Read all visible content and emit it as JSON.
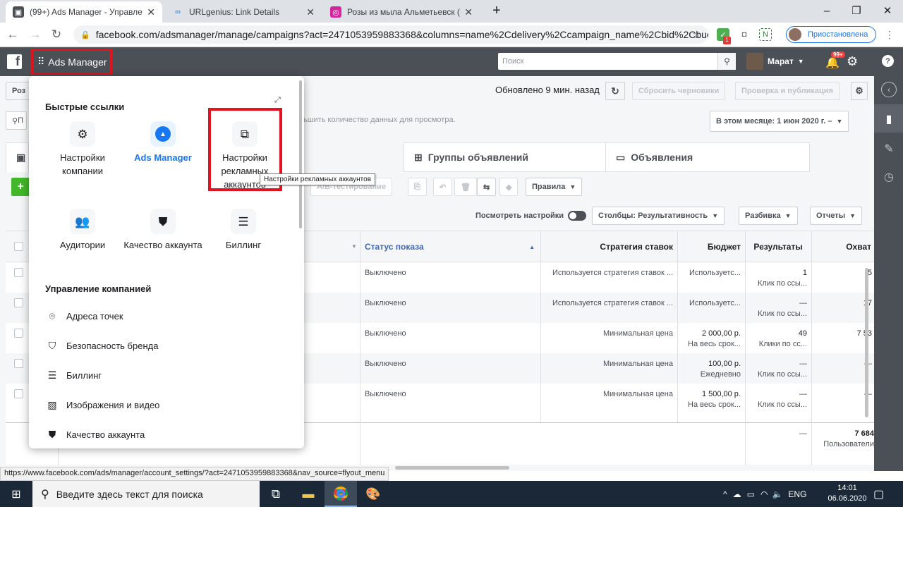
{
  "browser": {
    "tabs": [
      {
        "title": "(99+) Ads Manager - Управлени",
        "active": true
      },
      {
        "title": "URLgenius: Link Details",
        "active": false
      },
      {
        "title": "Розы из мыла Альметьевск (@а",
        "active": false
      }
    ],
    "new_tab": "+",
    "url": "facebook.com/adsmanager/manage/campaigns?act=2471053959883368&columns=name%2Cdelivery%2Ccampaign_name%2Cbid%2Cbudge...",
    "profile_label": "Приостановлена",
    "ext_badge": "1"
  },
  "fb": {
    "logo": "f",
    "app_title": "Ads Manager",
    "search_placeholder": "Поиск",
    "user_name": "Марат",
    "notif_badge": "99+"
  },
  "toolbar": {
    "left_button": "Роз",
    "updated": "Обновлено 9 мин. назад",
    "reset_drafts": "Сбросить черновики",
    "review_publish": "Проверка и публикация",
    "info_text": "ьшить количество данных для просмотра.",
    "date_range": "В этом месяце: 1 июн 2020 г. –",
    "rules": "Правила",
    "view_settings": "Посмотреть настройки",
    "columns": "Столбцы: Результативность",
    "breakdown": "Разбивка",
    "reports": "Отчеты",
    "test_label": "A/B-тестирование",
    "search_prefix": "П"
  },
  "level_tabs": {
    "adsets": "Группы объявлений",
    "ads": "Объявления"
  },
  "table": {
    "headers": {
      "delivery": "Статус показа",
      "bid": "Стратегия ставок",
      "budget": "Бюджет",
      "results": "Результаты",
      "reach": "Охват"
    },
    "rows": [
      {
        "delivery": "Выключено",
        "bid": "Используется стратегия ставок ...",
        "budget": "Используетс...",
        "budget2": "",
        "results": "1",
        "results2": "Клик по ссы...",
        "reach": "5"
      },
      {
        "delivery": "Выключено",
        "bid": "Используется стратегия ставок ...",
        "budget": "Используетс...",
        "budget2": "",
        "results": "—",
        "results2": "Клик по ссы...",
        "reach": "17"
      },
      {
        "delivery": "Выключено",
        "bid": "Минимальная цена",
        "budget": "2 000,00 р.",
        "budget2": "На весь срок...",
        "results": "49",
        "results2": "Клики по сс...",
        "reach": "7 53"
      },
      {
        "delivery": "Выключено",
        "bid": "Минимальная цена",
        "budget": "100,00 р.",
        "budget2": "Ежедневно",
        "results": "—",
        "results2": "Клик по ссы...",
        "reach": "—"
      },
      {
        "delivery": "Выключено",
        "bid": "Минимальная цена",
        "budget": "1 500,00 р.",
        "budget2": "На весь срок...",
        "results": "—",
        "results2": "Клик по ссы...",
        "reach": "—"
      }
    ],
    "total_results": "—",
    "total_reach": "7 684",
    "total_reach_label": "Пользователи"
  },
  "menu": {
    "quick_links_title": "Быстрые ссылки",
    "quick_links": [
      {
        "label": "Настройки компании",
        "icon": "gear-icon"
      },
      {
        "label": "Ads Manager",
        "icon": "ads-manager-icon"
      },
      {
        "label": "Настройки рекламных аккаунтов",
        "icon": "ad-account-settings-icon"
      },
      {
        "label": "Аудитории",
        "icon": "audiences-icon"
      },
      {
        "label": "Качество аккаунта",
        "icon": "shield-icon"
      },
      {
        "label": "Биллинг",
        "icon": "billing-icon"
      }
    ],
    "manage_title": "Управление компанией",
    "manage_items": [
      {
        "label": "Адреса точек",
        "icon": "location-icon"
      },
      {
        "label": "Безопасность бренда",
        "icon": "shield-icon"
      },
      {
        "label": "Биллинг",
        "icon": "billing-icon"
      },
      {
        "label": "Изображения и видео",
        "icon": "image-icon"
      },
      {
        "label": "Качество аккаунта",
        "icon": "shield-icon"
      }
    ],
    "tooltip": "Настройки рекламных аккаунтов"
  },
  "status_url": "https://www.facebook.com/ads/manager/account_settings/?act=2471053959883368&nav_source=flyout_menu",
  "taskbar": {
    "search_placeholder": "Введите здесь текст для поиска",
    "lang": "ENG",
    "time": "14:01",
    "date": "06.06.2020"
  },
  "colors": {
    "fb_header": "#4b4f56",
    "highlight": "#e0131f",
    "link": "#4267b2",
    "ads_blue": "#1877f2"
  }
}
